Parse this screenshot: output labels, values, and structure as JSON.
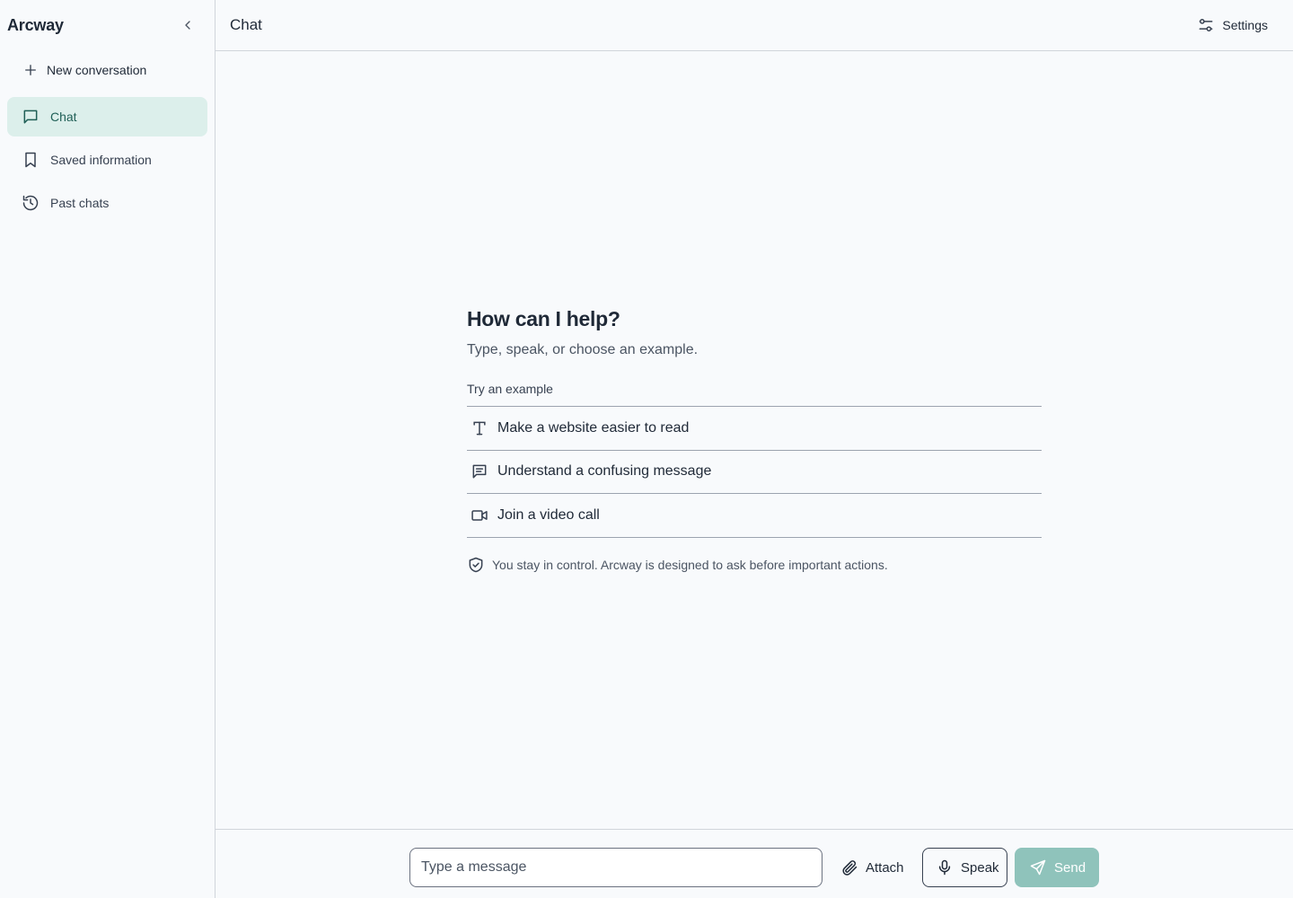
{
  "sidebar": {
    "brand": "Arcway",
    "new_conversation": "New conversation",
    "items": [
      {
        "label": "Chat",
        "icon": "message-square-icon",
        "active": true
      },
      {
        "label": "Saved information",
        "icon": "bookmark-icon",
        "active": false
      },
      {
        "label": "Past chats",
        "icon": "history-icon",
        "active": false
      }
    ]
  },
  "header": {
    "title": "Chat",
    "settings_label": "Settings"
  },
  "welcome": {
    "title": "How can I help?",
    "subtitle": "Type, speak, or choose an example.",
    "examples_label": "Try an example",
    "examples": [
      {
        "label": "Make a website easier to read",
        "icon": "text-type-icon"
      },
      {
        "label": "Understand a confusing message",
        "icon": "message-text-icon"
      },
      {
        "label": "Join a video call",
        "icon": "video-icon"
      }
    ],
    "control_note": "You stay in control. Arcway is designed to ask before important actions."
  },
  "composer": {
    "placeholder": "Type a message",
    "value": "",
    "attach_label": "Attach",
    "speak_label": "Speak",
    "send_label": "Send"
  },
  "colors": {
    "accent": "#1f5f56",
    "active_bg": "#dcefeb",
    "send_bg": "#8fc3bb",
    "background": "#f8fafc"
  }
}
